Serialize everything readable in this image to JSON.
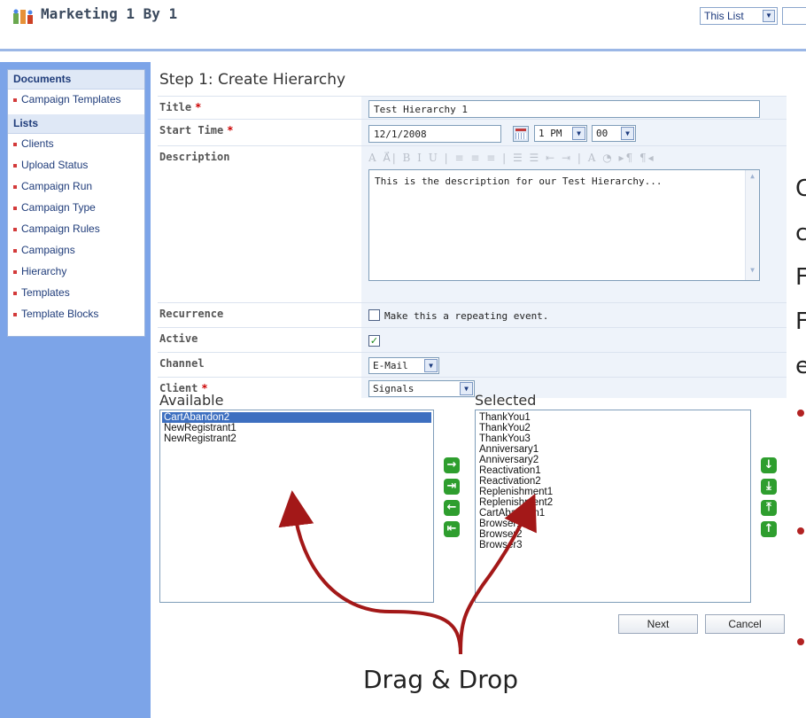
{
  "header": {
    "site_title": "Marketing 1 By 1",
    "scope_select": "This List"
  },
  "sidebar": {
    "sections": [
      {
        "title": "Documents",
        "items": [
          "Campaign Templates"
        ]
      },
      {
        "title": "Lists",
        "items": [
          "Clients",
          "Upload Status",
          "Campaign Run",
          "Campaign Type",
          "Campaign Rules",
          "Campaigns",
          "Hierarchy",
          "Templates",
          "Template Blocks"
        ]
      }
    ]
  },
  "main": {
    "step_title": "Step 1: Create Hierarchy",
    "fields": {
      "title_label": "Title",
      "title_value": "Test Hierarchy 1",
      "start_time_label": "Start Time",
      "start_date": "12/1/2008",
      "start_hour": "1 PM",
      "start_minute": "00",
      "description_label": "Description",
      "description_toolbar": "A A⃗| B I U | ≡ ≡ ≡ | ☰ ☰ ⇤ ⇥ | A ◔ ▸¶ ¶◂",
      "description_value": "This is the description for our Test Hierarchy...",
      "recurrence_label": "Recurrence",
      "recurrence_text": "Make this a repeating event.",
      "active_label": "Active",
      "active_checked": true,
      "channel_label": "Channel",
      "channel_value": "E-Mail",
      "client_label": "Client",
      "client_value": "Signals",
      "required_marker": "*"
    },
    "available_title": "Available",
    "available_items": [
      "CartAbandon2",
      "NewRegistrant1",
      "NewRegistrant2"
    ],
    "selected_title": "Selected",
    "selected_items": [
      "ThankYou1",
      "ThankYou2",
      "ThankYou3",
      "Anniversary1",
      "Anniversary2",
      "Reactivation1",
      "Reactivation2",
      "Replenishment1",
      "Replenishment2",
      "CartAbandon1",
      "Browser1",
      "Browser2",
      "Browser3"
    ],
    "buttons": {
      "next": "Next",
      "cancel": "Cancel"
    }
  },
  "annotation": {
    "callout": "Drag & Drop",
    "arrow_color": "#a31818"
  },
  "cutoff_text": [
    "C",
    "c",
    "F",
    "F",
    "e"
  ]
}
